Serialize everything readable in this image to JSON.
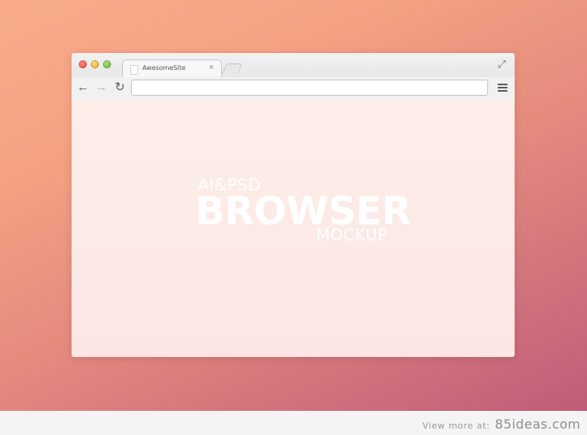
{
  "browser": {
    "tab": {
      "title": "AwesomeSite",
      "close_symbol": "×"
    },
    "icons": {
      "close_light": "close-traffic-light",
      "minimize_light": "minimize-traffic-light",
      "maximize_light": "maximize-traffic-light",
      "fullscreen": "fullscreen-arrows",
      "back": "back-arrow",
      "forward": "forward-arrow",
      "reload": "reload",
      "menu": "hamburger-menu"
    },
    "address_bar": {
      "value": "",
      "placeholder": ""
    },
    "glyphs": {
      "back": "←",
      "forward": "→",
      "reload": "↻",
      "fullscreen": "⤢"
    },
    "colors": {
      "close": "#e0443a",
      "minimize": "#e3a21a",
      "maximize": "#57b13a"
    }
  },
  "page": {
    "hero_top": "AI&PSD",
    "hero_main": "BROWSER",
    "hero_bottom": "MOCKUP"
  },
  "footer": {
    "credit_prefix": "View more at:",
    "credit_site": "85ideas.com"
  }
}
